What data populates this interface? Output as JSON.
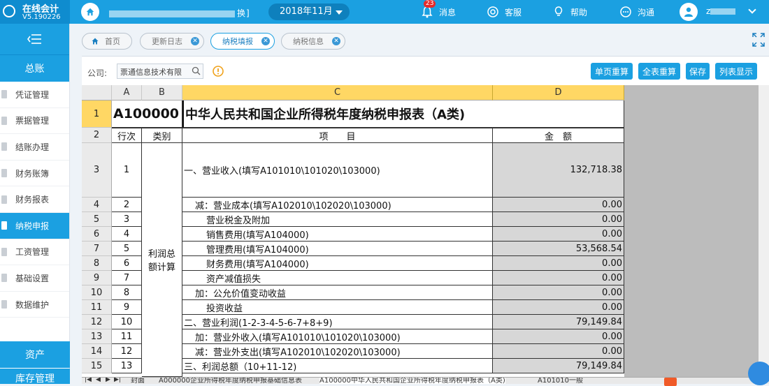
{
  "app": {
    "name": "在线会计",
    "version": "V5.190226"
  },
  "topbar": {
    "company": "丨",
    "company_suffix": "换]",
    "period": "2018年11月",
    "messages_label": "消息",
    "messages_count": "23",
    "service_label": "客服",
    "help_label": "帮助",
    "chat_label": "沟通",
    "user_initial": "z"
  },
  "sidebar": {
    "section_top": "总账",
    "items": [
      {
        "label": "凭证管理",
        "active": false
      },
      {
        "label": "票据管理",
        "active": false
      },
      {
        "label": "结账办理",
        "active": false
      },
      {
        "label": "财务账簿",
        "active": false
      },
      {
        "label": "财务报表",
        "active": false
      },
      {
        "label": "纳税申报",
        "active": true
      },
      {
        "label": "工资管理",
        "active": false
      },
      {
        "label": "基础设置",
        "active": false
      },
      {
        "label": "数据维护",
        "active": false
      }
    ],
    "section_asset": "资产",
    "section_stock": "库存管理"
  },
  "tabs": [
    {
      "label": "首页",
      "closable": false,
      "active": false
    },
    {
      "label": "更新日志",
      "closable": true,
      "active": false
    },
    {
      "label": "纳税填报",
      "closable": true,
      "active": true
    },
    {
      "label": "纳税信息",
      "closable": true,
      "active": false
    }
  ],
  "toolbar": {
    "company_label": "公司:",
    "company_value": "票通信息技术有限",
    "buttons": [
      "单页重算",
      "全表重算",
      "保存",
      "列表显示"
    ]
  },
  "sheet": {
    "columns": [
      "A",
      "B",
      "C",
      "D"
    ],
    "form_code": "A100000",
    "form_title": "中华人民共和国企业所得税年度纳税申报表（A类)",
    "header": {
      "seq": "行次",
      "category": "类别",
      "item": "项　　目",
      "amount": "金　额"
    },
    "category_text": "利润总额计算",
    "rows": [
      {
        "row": "3",
        "seq": "1",
        "item": "一、营业收入(填写A101010\\101020\\103000)",
        "amount": "132,718.38",
        "indent": 0
      },
      {
        "row": "4",
        "seq": "2",
        "item": "减：营业成本(填写A102010\\102020\\103000)",
        "amount": "0.00",
        "indent": 1
      },
      {
        "row": "5",
        "seq": "3",
        "item": "营业税金及附加",
        "amount": "0.00",
        "indent": 2
      },
      {
        "row": "6",
        "seq": "4",
        "item": "销售费用(填写A104000)",
        "amount": "0.00",
        "indent": 2
      },
      {
        "row": "7",
        "seq": "5",
        "item": "管理费用(填写A104000)",
        "amount": "53,568.54",
        "indent": 2
      },
      {
        "row": "8",
        "seq": "6",
        "item": "财务费用(填写A104000)",
        "amount": "0.00",
        "indent": 2
      },
      {
        "row": "9",
        "seq": "7",
        "item": "资产减值损失",
        "amount": "0.00",
        "indent": 2
      },
      {
        "row": "10",
        "seq": "8",
        "item": "加：公允价值变动收益",
        "amount": "0.00",
        "indent": 1
      },
      {
        "row": "11",
        "seq": "9",
        "item": "投资收益",
        "amount": "0.00",
        "indent": 2
      },
      {
        "row": "12",
        "seq": "10",
        "item": "二、营业利润(1-2-3-4-5-6-7+8+9)",
        "amount": "79,149.84",
        "indent": 0
      },
      {
        "row": "13",
        "seq": "11",
        "item": "加：营业外收入(填写A101010\\101020\\103000)",
        "amount": "0.00",
        "indent": 1
      },
      {
        "row": "14",
        "seq": "12",
        "item": "减：营业外支出(填写A102010\\102020\\103000)",
        "amount": "0.00",
        "indent": 1
      },
      {
        "row": "15",
        "seq": "13",
        "item": "三、利润总额（10+11-12)",
        "amount": "79,149.84",
        "indent": 0
      }
    ],
    "row_labels_top": [
      "1",
      "2"
    ]
  },
  "sheet_tabs": [
    {
      "label": "封面",
      "active": false
    },
    {
      "label": "A000000企业所得税年度纳税申报基础信息表",
      "active": false
    },
    {
      "label": "A100000中华人民共和国企业所得税年度纳税申报表（A类)",
      "active": true
    },
    {
      "label": "A101010一般",
      "active": false
    }
  ],
  "colors": {
    "accent": "#1ba0e1",
    "selected_header": "#ffd764",
    "badge": "#e52b2b"
  }
}
